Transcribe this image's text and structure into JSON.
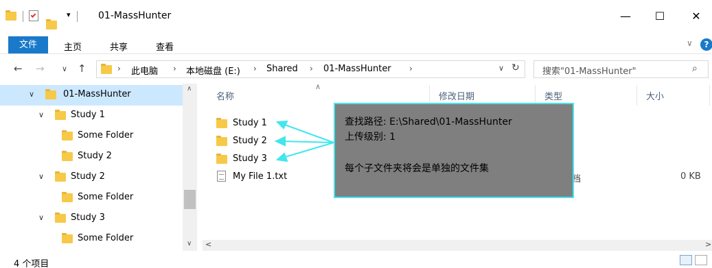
{
  "window": {
    "title": "01-MassHunter",
    "minimize_glyph": "—",
    "maximize_glyph": "☐",
    "close_glyph": "✕"
  },
  "ribbon": {
    "tabs": [
      "文件",
      "主页",
      "共享",
      "查看"
    ],
    "help_glyph": "?"
  },
  "nav": {
    "breadcrumb": [
      "此电脑",
      "本地磁盘 (E:)",
      "Shared",
      "01-MassHunter"
    ],
    "search_placeholder": "搜索\"01-MassHunter\""
  },
  "tree": [
    {
      "label": "01-MassHunter",
      "selected": true,
      "expandable": true
    },
    {
      "label": "Study 1",
      "expandable": true
    },
    {
      "label": "Some Folder"
    },
    {
      "label": "Study 2"
    },
    {
      "label": "Study 2",
      "expandable": true
    },
    {
      "label": "Some Folder"
    },
    {
      "label": "Study 3",
      "expandable": true
    },
    {
      "label": "Some Folder"
    }
  ],
  "columns": [
    "名称",
    "修改日期",
    "类型",
    "大小"
  ],
  "files": [
    {
      "name": "Study 1",
      "kind": "folder"
    },
    {
      "name": "Study 2",
      "kind": "folder"
    },
    {
      "name": "Study 3",
      "kind": "folder"
    },
    {
      "name": "My File 1.txt",
      "kind": "text",
      "type_tail": "档",
      "size": "0 KB"
    }
  ],
  "status": {
    "item_count": "4 个项目"
  },
  "annotation": {
    "line1": "查找路径: E:\\Shared\\01-MassHunter",
    "line2": "上传级别: 1",
    "line3": "每个子文件夹将会是单独的文件集",
    "border_color": "#41e6ee",
    "fill_color": "#7f7f7f"
  }
}
